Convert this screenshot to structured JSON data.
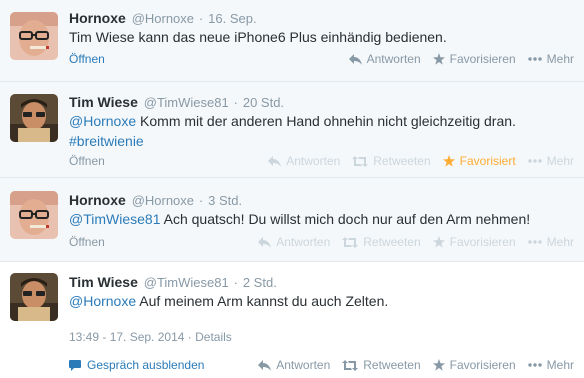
{
  "tweets": [
    {
      "fullname": "Hornoxe",
      "username": "@Hornoxe",
      "time": "16. Sep.",
      "text": "Tim Wiese kann das neue iPhone6 Plus einhändig bedienen.",
      "expand": "Öffnen",
      "actions": {
        "reply": "Antworten",
        "favorite": "Favorisieren",
        "more": "Mehr"
      }
    },
    {
      "fullname": "Tim Wiese",
      "username": "@TimWiese81",
      "time": "20 Std.",
      "mention": "@Hornoxe",
      "text": " Komm mit der anderen Hand ohnehin nicht gleichzeitig dran.",
      "hashtag": "#breitwienie",
      "expand": "Öffnen",
      "actions": {
        "reply": "Antworten",
        "retweet": "Retweeten",
        "favorite": "Favorisiert",
        "more": "Mehr"
      }
    },
    {
      "fullname": "Hornoxe",
      "username": "@Hornoxe",
      "time": "3 Std.",
      "mention": "@TimWiese81",
      "text": " Ach quatsch! Du willst mich doch nur auf den Arm nehmen!",
      "expand": "Öffnen",
      "actions": {
        "reply": "Antworten",
        "retweet": "Retweeten",
        "favorite": "Favorisieren",
        "more": "Mehr"
      }
    },
    {
      "fullname": "Tim Wiese",
      "username": "@TimWiese81",
      "time": "2 Std.",
      "mention": "@Hornoxe",
      "text": " Auf meinem Arm kannst du auch Zelten.",
      "timestamp": "13:49 - 17. Sep. 2014",
      "details": "Details",
      "conversation": "Gespräch ausblenden",
      "actions": {
        "reply": "Antworten",
        "retweet": "Retweeten",
        "favorite": "Favorisieren",
        "more": "Mehr"
      }
    }
  ],
  "colors": {
    "link": "#2b7bb9",
    "muted": "#8899a6",
    "favorited": "#ffac33"
  },
  "icons": [
    "reply-icon",
    "retweet-icon",
    "star-icon",
    "more-icon",
    "conversation-icon"
  ]
}
